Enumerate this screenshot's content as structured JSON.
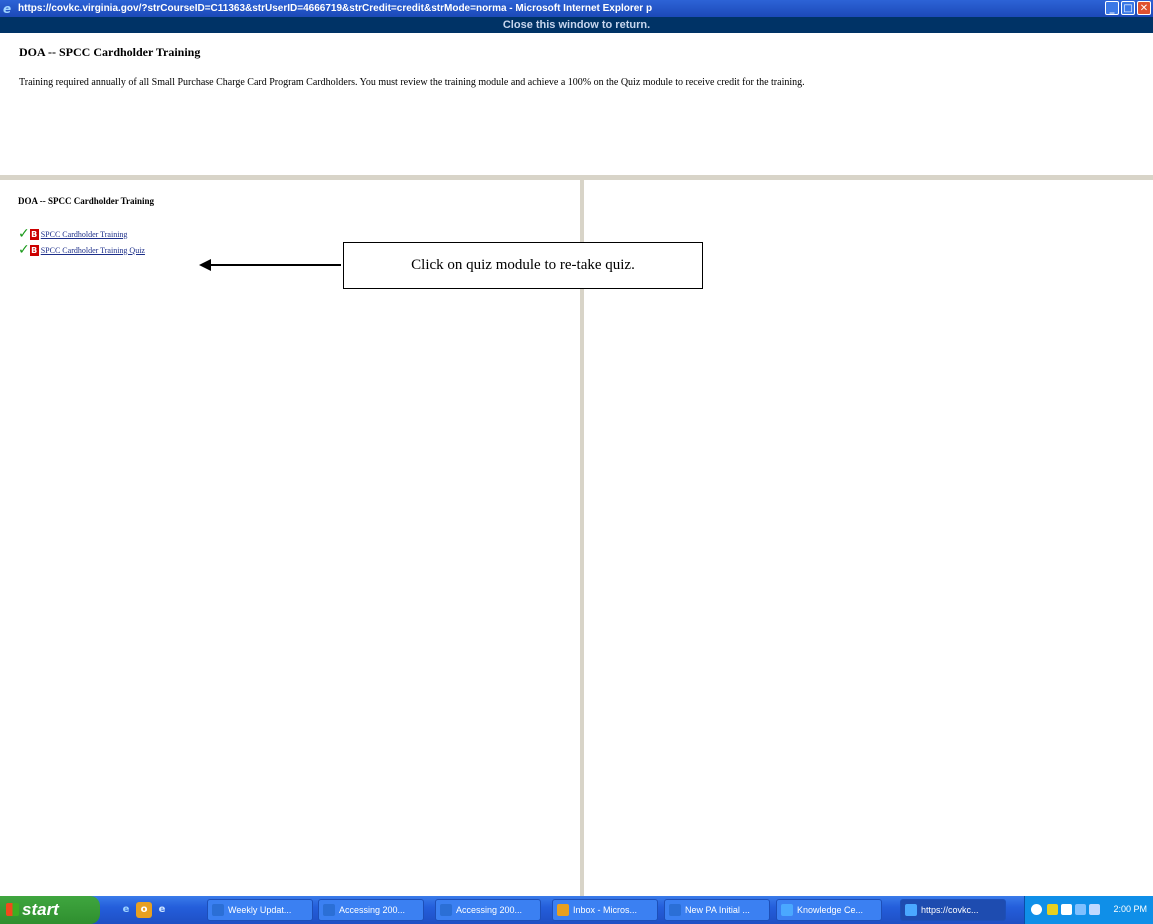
{
  "window": {
    "title": "https://covkc.virginia.gov/?strCourseID=C11363&strUserID=4666719&strCredit=credit&strMode=norma - Microsoft Internet Explorer p",
    "ie_icon": "ie-icon",
    "buttons": {
      "minimize": "minimize-icon",
      "maximize": "maximize-icon",
      "close": "close-icon"
    }
  },
  "closebar": {
    "text": "Close this window to return."
  },
  "header": {
    "title": "DOA -- SPCC Cardholder Training",
    "description": "Training required annually of all Small Purchase Charge Card Program Cardholders. You must review the training module and achieve a 100% on the Quiz module to receive credit for the training."
  },
  "left_pane": {
    "title": "DOA -- SPCC Cardholder Training",
    "modules": [
      {
        "label": "SPCC Cardholder Training",
        "status_icon": "check-icon",
        "type_icon": "module-icon"
      },
      {
        "label": "SPCC Cardholder Training Quiz",
        "status_icon": "check-icon",
        "type_icon": "module-icon"
      }
    ]
  },
  "callout": {
    "text": "Click on quiz module to re-take quiz."
  },
  "taskbar": {
    "start_label": "start",
    "tasks": [
      {
        "label": "Weekly Updat...",
        "icon_color": "#2b6fd6"
      },
      {
        "label": "Accessing 200...",
        "icon_color": "#2b6fd6"
      },
      {
        "label": "Accessing 200...",
        "icon_color": "#2b6fd6"
      },
      {
        "label": "Inbox - Micros...",
        "icon_color": "#e8a020"
      },
      {
        "label": "New PA Initial ...",
        "icon_color": "#2b6fd6"
      },
      {
        "label": "Knowledge Ce...",
        "icon_color": "#4aa8ff"
      },
      {
        "label": "https://covkc...",
        "icon_color": "#4aa8ff"
      }
    ],
    "clock": "2:00 PM"
  }
}
